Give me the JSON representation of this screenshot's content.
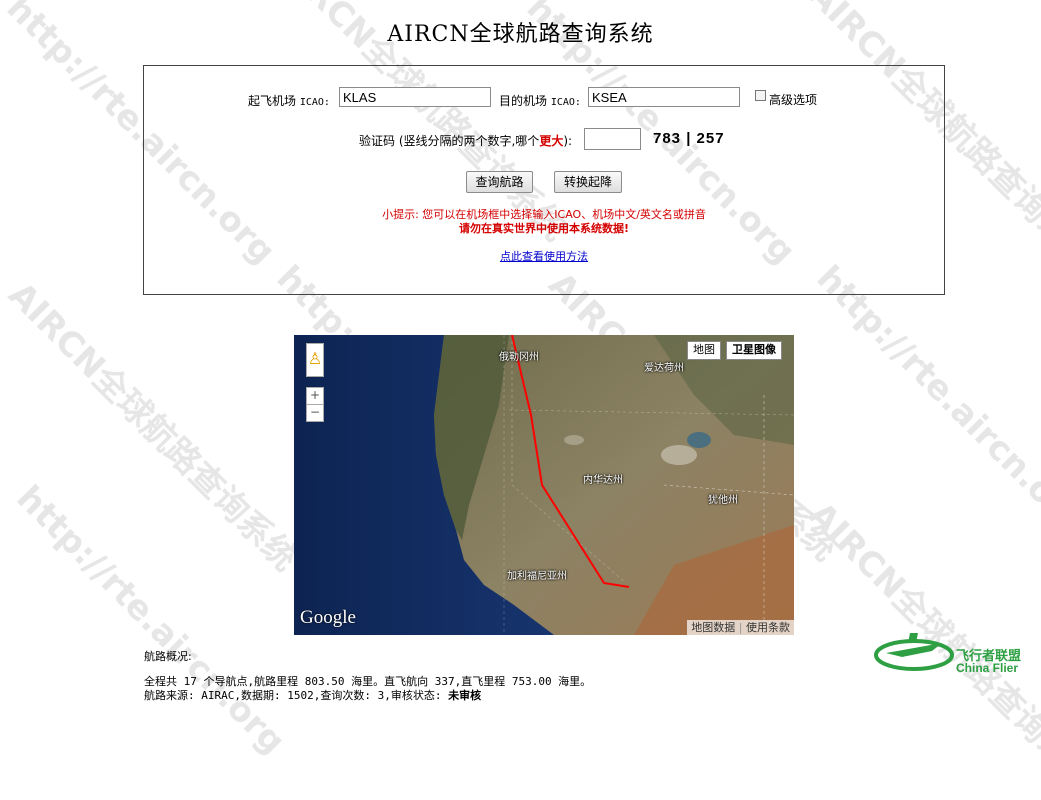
{
  "page": {
    "title": "AIRCN全球航路查询系统",
    "watermark": "http://rte.aircn.org",
    "watermark2": "AIRCN全球航路查询系统"
  },
  "form": {
    "departure_label_prefix": "起飞机场 ",
    "departure_label_icao": "ICAO:",
    "departure_value": "KLAS",
    "arrival_label_prefix": "目的机场 ",
    "arrival_label_icao": "ICAO:",
    "arrival_value": "KSEA",
    "advanced_label": "高级选项",
    "captcha_label_pre": "验证码 (竖线分隔的两个数字,哪个",
    "captcha_label_em": "更大",
    "captcha_label_post": "):",
    "captcha_value": "",
    "captcha_image_text": "783 | 257",
    "search_button": "查询航路",
    "swap_button": "转换起降",
    "tip_line": "小提示: 您可以在机场框中选择输入ICAO、机场中文/英文名或拼音",
    "warning_line": "请勿在真实世界中使用本系统数据!",
    "help_link": "点此查看使用方法"
  },
  "map": {
    "type_map": "地图",
    "type_satellite": "卫星图像",
    "zoom_in": "+",
    "zoom_out": "−",
    "labels": {
      "oregon": "俄勒冈州",
      "idaho": "爱达荷州",
      "nevada": "内华达州",
      "utah": "犹他州",
      "california": "加利福尼亚州"
    },
    "logo": "Google",
    "map_data": "地图数据",
    "terms": "使用条款",
    "route_color": "#ff0000"
  },
  "summary": {
    "heading": "航路概况:",
    "line1": "全程共 17 个导航点,航路里程 803.50 海里。直飞航向 337,直飞里程 753.00 海里。",
    "line2_pre": "航路来源: AIRAC,数据期: 1502,查询次数: 3,审核状态: ",
    "line2_status": "未审核"
  },
  "brand": {
    "name_cn": "飞行者联盟",
    "name_en": "China Flier",
    "color": "#2ea043"
  }
}
